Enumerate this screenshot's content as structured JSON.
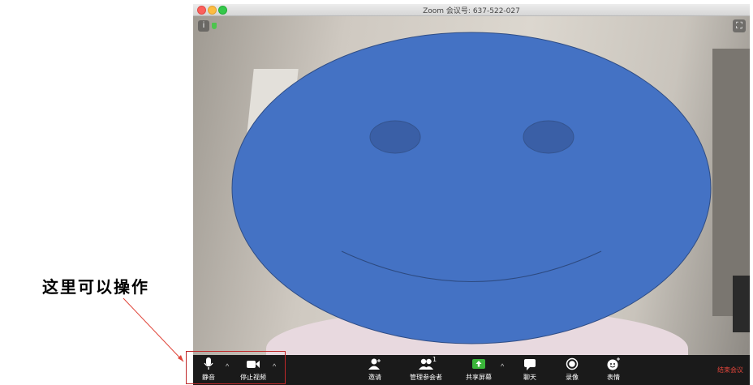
{
  "annotation": {
    "text": "这里可以操作"
  },
  "window": {
    "title": "Zoom 会议号: 637-522-027"
  },
  "toolbar": {
    "mute_label": "静音",
    "stop_video_label": "停止视频",
    "invite_label": "邀请",
    "participants_label": "管理参会者",
    "participants_count": "1",
    "share_label": "共享屏幕",
    "chat_label": "聊天",
    "record_label": "录像",
    "reactions_label": "表情",
    "end_label": "结束会议"
  },
  "icons": {
    "info": "i",
    "fullscreen": "⛶",
    "caret": "^"
  },
  "colors": {
    "face_fill": "#4472c4",
    "eye_fill": "#3a5fa6",
    "annotation_red": "#c0292a",
    "end_red": "#e0453a",
    "share_green": "#3ab53a"
  }
}
